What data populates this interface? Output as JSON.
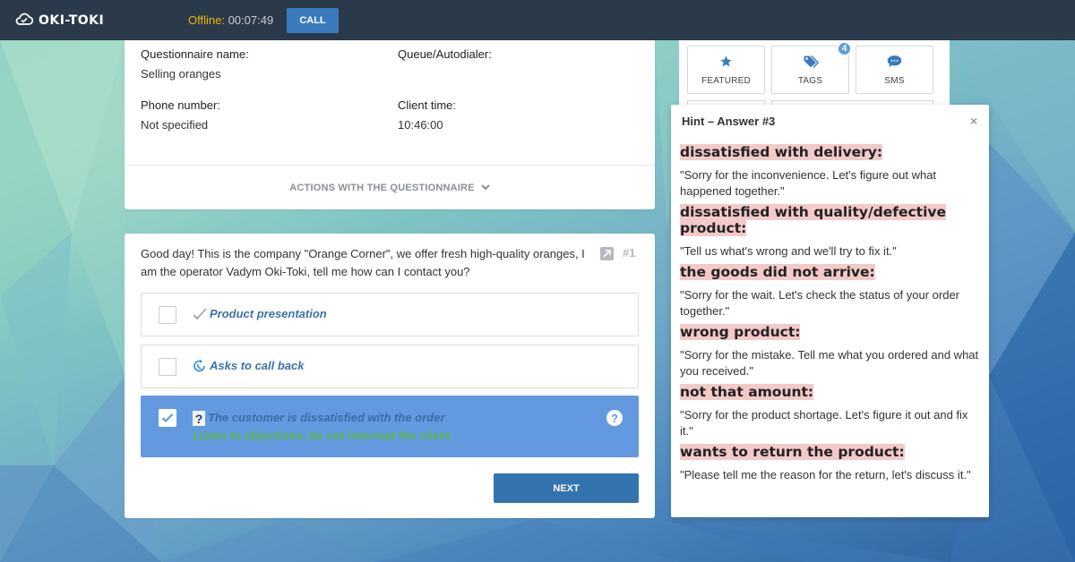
{
  "header": {
    "logo": "OKI-TOKI",
    "status_label": "Offline:",
    "status_time": "00:07:49",
    "call_button": "CALL"
  },
  "info": {
    "questionnaire_label": "Questionnaire name:",
    "questionnaire_value": "Selling oranges",
    "queue_label": "Queue/Autodialer:",
    "queue_value": "",
    "phone_label": "Phone number:",
    "phone_value": "Not specified",
    "client_time_label": "Client time:",
    "client_time_value": "10:46:00",
    "actions_label": "ACTIONS WITH THE QUESTIONNAIRE"
  },
  "question": {
    "text": "Good day! This is the company \"Orange Corner\", we offer fresh high-quality oranges, I am the operator Vadym Oki-Toki, tell me how can I contact you?",
    "number": "#1",
    "answers": [
      {
        "label": "Product presentation",
        "selected": false
      },
      {
        "label": "Asks to call back",
        "selected": false
      },
      {
        "label": "The customer is dissatisfied with the order",
        "sub": "Listen to objections, do not interrupt the client",
        "selected": true
      }
    ],
    "next_button": "NEXT"
  },
  "tiles": [
    {
      "label": "FEATURED",
      "icon": "star-icon"
    },
    {
      "label": "TAGS",
      "icon": "tags-icon",
      "badge": "4"
    },
    {
      "label": "SMS",
      "icon": "chat-icon"
    }
  ],
  "hint": {
    "title": "Hint – Answer #3",
    "close": "×",
    "items": [
      {
        "heading": "dissatisfied with delivery:",
        "text": "\"Sorry for the inconvenience. Let's figure out what happened together.\""
      },
      {
        "heading": "dissatisfied with quality/defective product:",
        "text": "\"Tell us what's wrong and we'll try to fix it.\""
      },
      {
        "heading": "the goods did not arrive:",
        "text": "\"Sorry for the wait. Let's check the status of your order together.\""
      },
      {
        "heading": "wrong product:",
        "text": "\"Sorry for the mistake. Tell me what you ordered and what you received.\""
      },
      {
        "heading": "not that amount:",
        "text": "\"Sorry for the product shortage. Let's figure it out and fix it.\""
      },
      {
        "heading": "wants to return the product:",
        "text": "\"Please tell me the reason for the return, let's discuss it.\""
      }
    ]
  },
  "colors": {
    "topbar": "#2b3a4a",
    "accent": "#3a7bbd",
    "selected_answer": "#6399de",
    "offline": "#f0b400",
    "hint_highlight": "#f4c9c9",
    "sub_green": "#5ab64f"
  }
}
